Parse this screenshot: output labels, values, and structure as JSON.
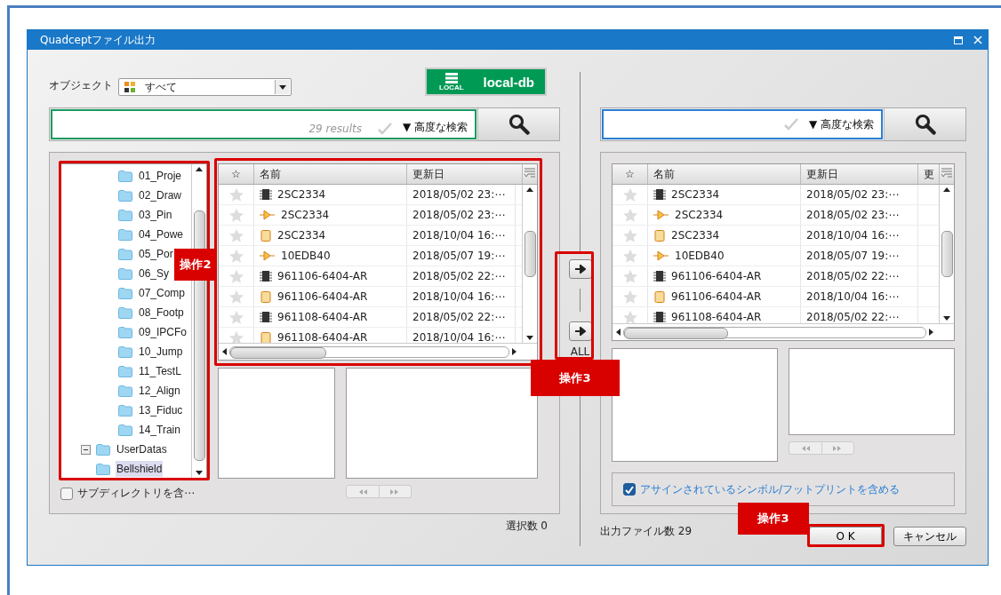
{
  "window": {
    "title": "Quadceptファイル出力"
  },
  "left": {
    "object_label": "オブジェクト",
    "object_value": "すべて",
    "db_button": {
      "icon_label": "LOCAL",
      "label": "local-db"
    },
    "search": {
      "results": "29 results",
      "advanced": "▼ 高度な検索"
    },
    "tree": {
      "scrolled_items": [
        {
          "label": "01_Proje",
          "selected": false
        },
        {
          "label": "02_Draw",
          "selected": false
        },
        {
          "label": "03_Pin",
          "selected": false
        },
        {
          "label": "04_Powe",
          "selected": false
        },
        {
          "label": "05_Por",
          "selected": false
        },
        {
          "label": "06_Sy",
          "selected": false
        },
        {
          "label": "07_Comp",
          "selected": false
        },
        {
          "label": "08_Footp",
          "selected": false
        },
        {
          "label": "09_IPCFo",
          "selected": false
        },
        {
          "label": "10_Jump",
          "selected": false
        },
        {
          "label": "11_TestL",
          "selected": false
        },
        {
          "label": "12_Align",
          "selected": false
        },
        {
          "label": "13_Fiduc",
          "selected": false
        },
        {
          "label": "14_Train",
          "selected": false
        }
      ],
      "items": [
        {
          "label": "UserDatas",
          "selected": false,
          "expanded": true,
          "children": [
            {
              "label": "Bellshield",
              "selected": true
            }
          ]
        }
      ]
    },
    "table": {
      "columns": [
        "☆",
        "名前",
        "更新日"
      ],
      "rows": [
        {
          "kind": "chip",
          "name": "2SC2334",
          "date": "2018/05/02 23:⋯"
        },
        {
          "kind": "symbol",
          "name": "2SC2334",
          "date": "2018/05/02 23:⋯"
        },
        {
          "kind": "footprint",
          "name": "2SC2334",
          "date": "2018/10/04 16:⋯"
        },
        {
          "kind": "symbol",
          "name": "10EDB40",
          "date": "2018/05/07 19:⋯"
        },
        {
          "kind": "chip",
          "name": "961106-6404-AR",
          "date": "2018/05/02 22:⋯"
        },
        {
          "kind": "footprint",
          "name": "961106-6404-AR",
          "date": "2018/10/04 16:⋯"
        },
        {
          "kind": "chip",
          "name": "961108-6404-AR",
          "date": "2018/05/02 22:⋯"
        },
        {
          "kind": "footprint",
          "name": "961108-6404-AR",
          "date": "2018/10/04 16:⋯"
        }
      ]
    },
    "subdir": {
      "label": "サブディレクトリを含⋯",
      "checked": false
    },
    "count": "選択数 0"
  },
  "transfer": {
    "all_label": "ALL"
  },
  "right": {
    "search": {
      "advanced": "▼ 高度な検索"
    },
    "table": {
      "columns": [
        "☆",
        "名前",
        "更新日",
        "更"
      ],
      "rows": [
        {
          "kind": "chip",
          "name": "2SC2334",
          "date": "2018/05/02 23:⋯"
        },
        {
          "kind": "symbol",
          "name": "2SC2334",
          "date": "2018/05/02 23:⋯"
        },
        {
          "kind": "footprint",
          "name": "2SC2334",
          "date": "2018/10/04 16:⋯"
        },
        {
          "kind": "symbol",
          "name": "10EDB40",
          "date": "2018/05/07 19:⋯"
        },
        {
          "kind": "chip",
          "name": "961106-6404-AR",
          "date": "2018/05/02 22:⋯"
        },
        {
          "kind": "footprint",
          "name": "961106-6404-AR",
          "date": "2018/10/04 16:⋯"
        },
        {
          "kind": "chip",
          "name": "961108-6404-AR",
          "date": "2018/05/02 22:⋯"
        }
      ]
    },
    "include": {
      "label": "アサインされているシンボル/フットプリントを含める",
      "checked": true
    },
    "count": "出力ファイル数 29",
    "ok": "O K",
    "cancel": "キャンセル"
  },
  "annotations": {
    "tree_and_list": "操作2",
    "transfer": "操作3",
    "ok": "操作3"
  }
}
